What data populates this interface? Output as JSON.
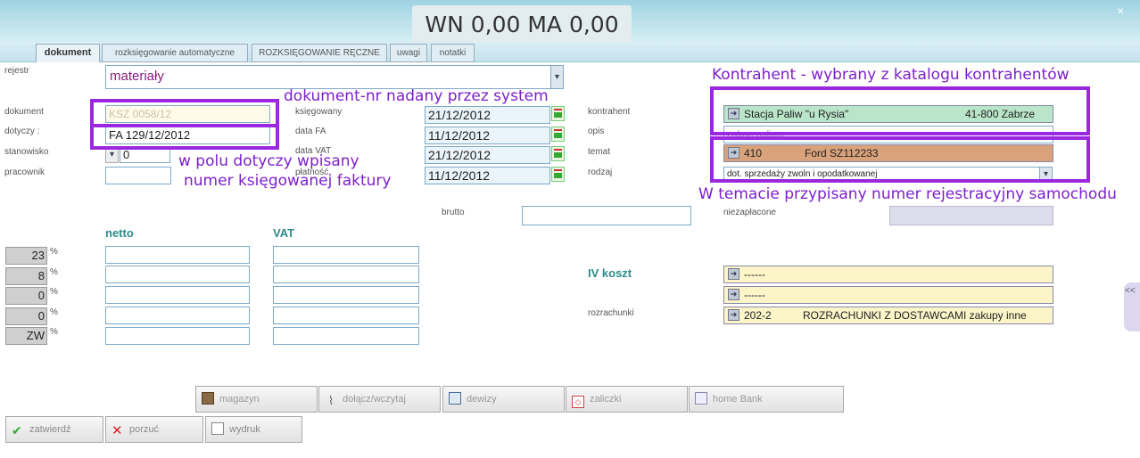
{
  "header": {
    "title": "WN 0,00 MA 0,00",
    "close": "×"
  },
  "tabs": [
    {
      "label": "dokument",
      "active": true
    },
    {
      "label": "rozksięgowanie automatyczne"
    },
    {
      "label": "ROZKSIĘGOWANIE RĘCZNE"
    },
    {
      "label": "uwagi"
    },
    {
      "label": "notatki"
    }
  ],
  "form": {
    "rejestr_label": "rejestr",
    "rejestr_value": "materiały",
    "dokument_label": "dokument",
    "dokument_value": "KSZ 0058/12",
    "dotyczy_label": "dotyczy :",
    "dotyczy_value": "FA 129/12/2012",
    "stanowisko_label": "stanowisko",
    "stanowisko_value": "0",
    "pracownik_label": "pracownik",
    "ksiegowany_label": "księgowany",
    "ksiegowany_value": "21/12/2012",
    "datafa_label": "data FA",
    "datafa_value": "11/12/2012",
    "datavat_label": "data VAT",
    "datavat_value": "21/12/2012",
    "platnosc_label": "płatność",
    "platnosc_value": "11/12/2012",
    "kontrahent_label": "kontrahent",
    "kontrahent_name": "Stacja Paliw  \"u Rysia\"",
    "kontrahent_city": "41-800 Zabrze",
    "opis_label": "opis",
    "opis_value": "zakup paliwa",
    "temat_label": "temat",
    "temat_code": "410",
    "temat_name": "Ford SZ112233",
    "rodzaj_label": "rodzaj",
    "rodzaj_value": "dot. sprzedaży zwoln i opodatkowanej",
    "brutto_label": "brutto",
    "niezaplacone_label": "niezapłacone",
    "netto_header": "netto",
    "vat_header": "VAT",
    "rates": [
      "23",
      "8",
      "0",
      "0",
      "ZW"
    ],
    "pct": "%",
    "iv_koszt_label": "IV koszt",
    "koszt1": "------",
    "koszt2": "------",
    "rozrachunki_label": "rozrachunki",
    "rozrachunki_code": "202-2",
    "rozrachunki_name": "ROZRACHUNKI Z DOSTAWCAMI zakupy inne"
  },
  "annotations": {
    "dokument_nr": "dokument-nr nadany przez system",
    "kontrahent": "Kontrahent - wybrany z katalogu kontrahentów",
    "dotyczy_line1": "w polu dotyczy wpisany",
    "dotyczy_line2": "numer księgowanej faktury",
    "temat": "W temacie przypisany numer rejestracyjny samochodu"
  },
  "buttons": {
    "magazyn": "magazyn",
    "dolacz": "dołącz/wczytaj",
    "dewizy": "dewizy",
    "zaliczki": "zaliczki",
    "homebank": "home Bank",
    "zatwierdz": "zatwierdź",
    "porzuc": "porzuć",
    "wydruk": "wydruk"
  },
  "side_tab": "<<",
  "colors": {
    "accent": "#9b27e0",
    "kontrahent_bg": "#b9e6c9",
    "temat_bg": "#d9a27a",
    "koszt_bg": "#fbf5c8"
  }
}
